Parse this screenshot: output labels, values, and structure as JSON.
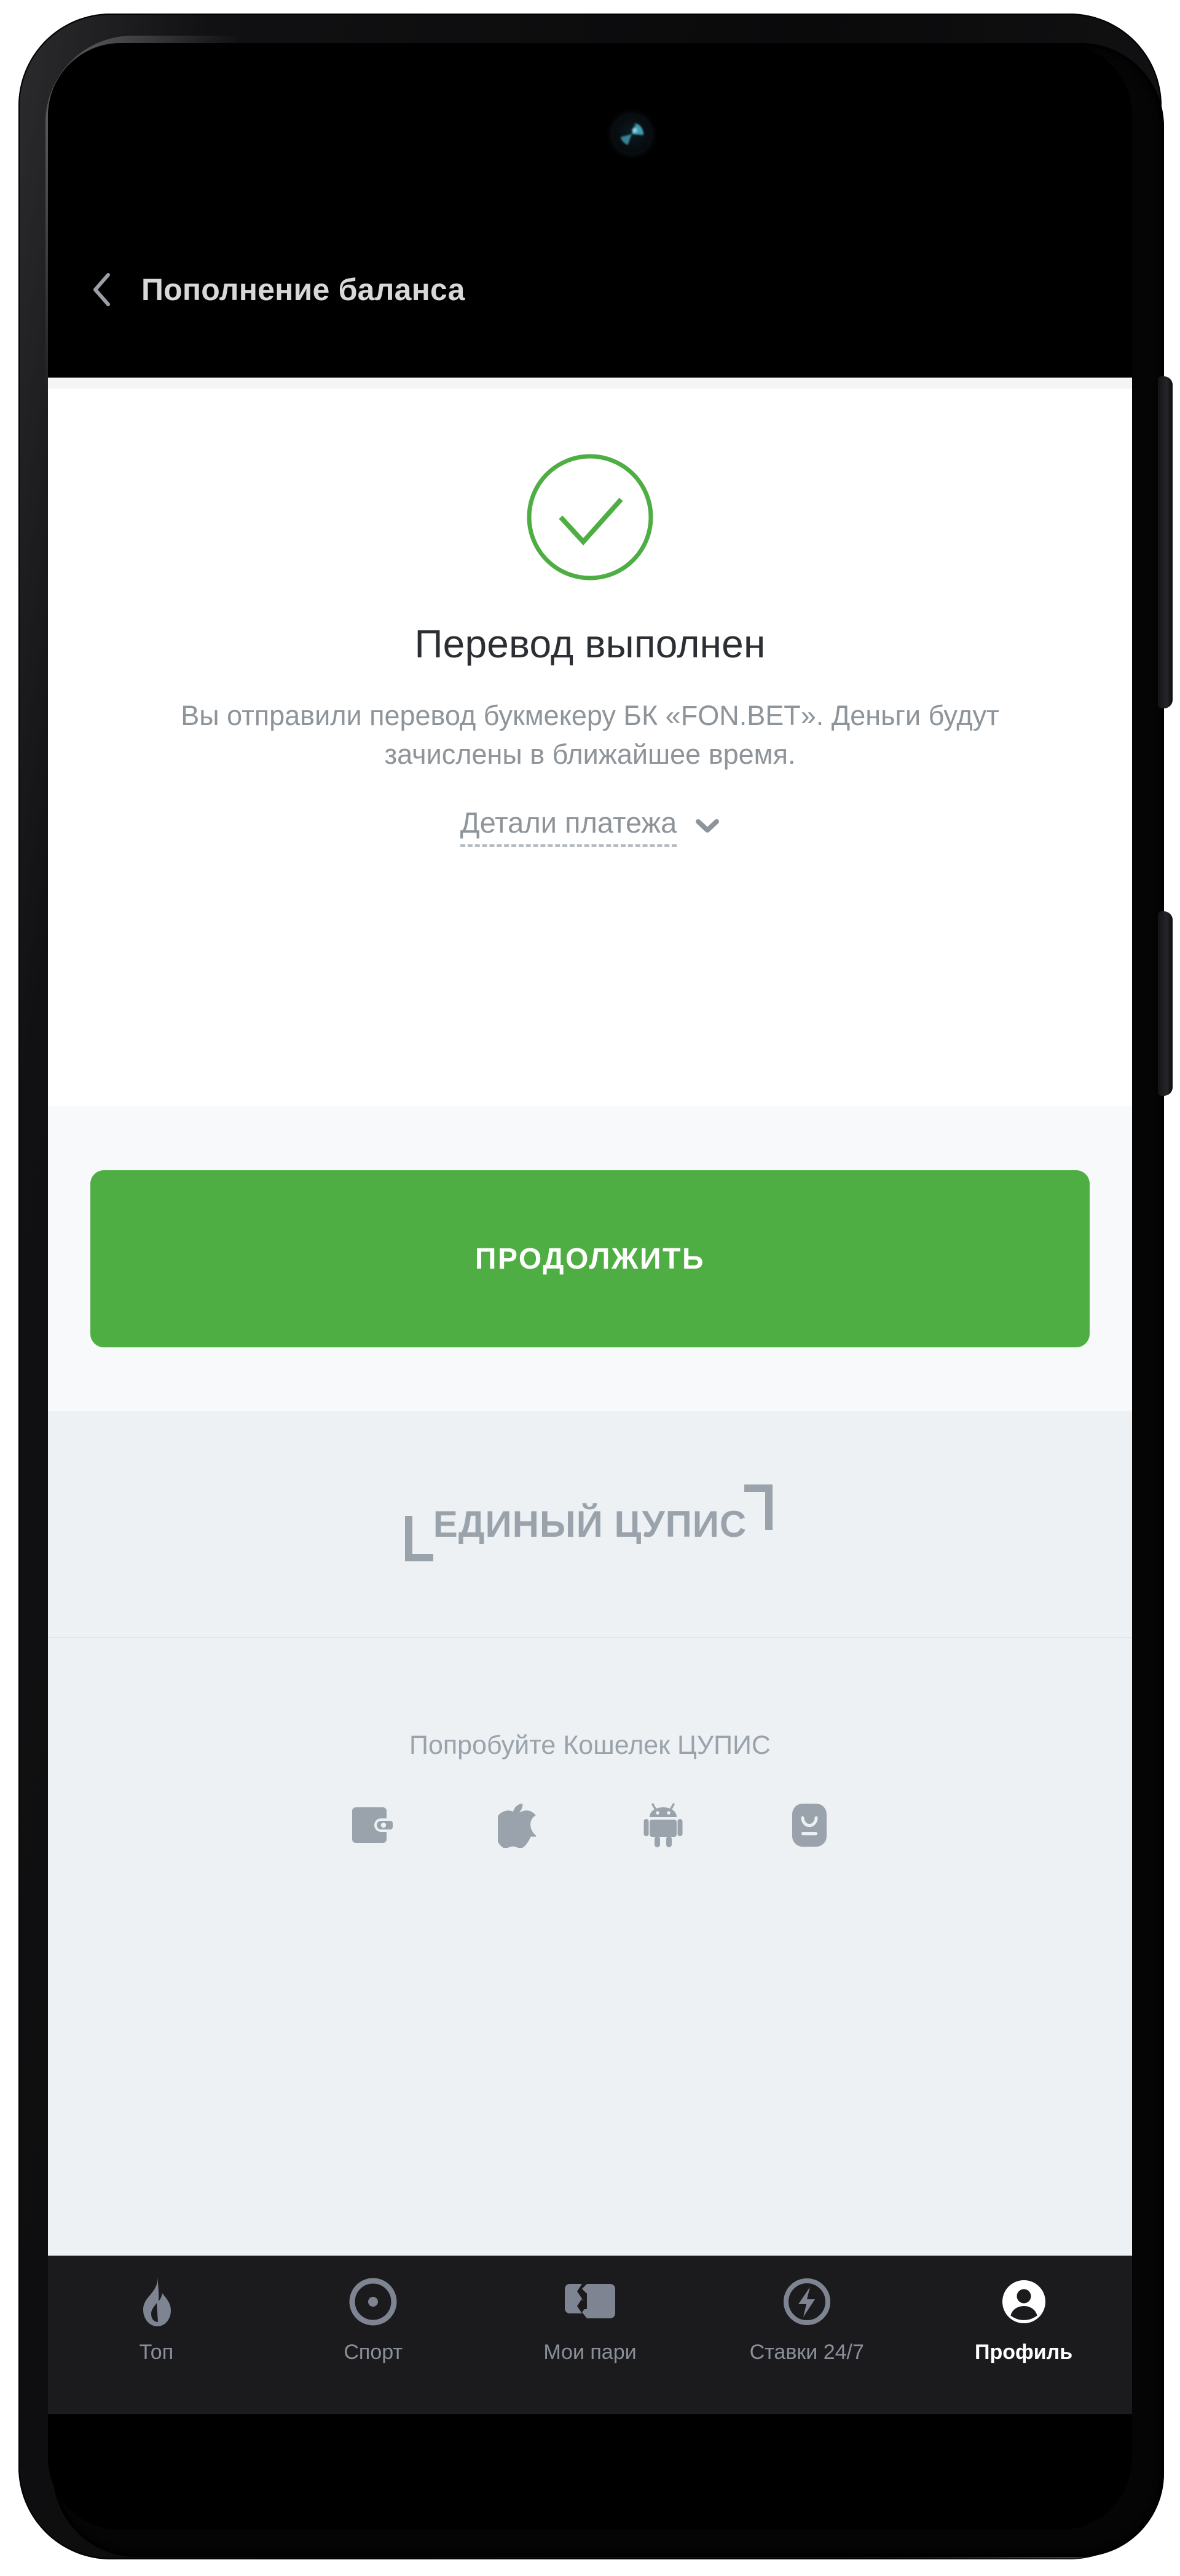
{
  "device": {
    "camera_icon": "front-camera-punch-hole",
    "hardware_buttons": [
      "volume-rocker",
      "power-button"
    ]
  },
  "header": {
    "back_icon": "chevron-left-icon",
    "title": "Пополнение баланса"
  },
  "success": {
    "status_icon": "check-circle-icon",
    "accent_color": "#4fae43",
    "title": "Перевод выполнен",
    "description": "Вы отправили перевод букмекеру БК «FON.BET». Деньги будут зачислены в ближайшее время.",
    "details_label": "Детали платежа",
    "details_caret_icon": "chevron-down-icon"
  },
  "cta": {
    "continue_label": "ПРОДОЛЖИТЬ",
    "color": "#4fae43"
  },
  "brand": {
    "logo_text": "ЕДИНЫЙ ЦУПИС",
    "bracket_left_icon": "corner-bracket-bottom-left-icon",
    "bracket_right_icon": "corner-bracket-top-right-icon",
    "color": "#9aa3ab"
  },
  "promo": {
    "text": "Попробуйте Кошелек ЦУПИС",
    "icons": [
      {
        "name": "wallet-icon"
      },
      {
        "name": "apple-icon"
      },
      {
        "name": "android-icon"
      },
      {
        "name": "appgallery-icon"
      }
    ]
  },
  "bottom_nav": {
    "items": [
      {
        "label": "Топ",
        "icon": "flame-icon",
        "active": false
      },
      {
        "label": "Спорт",
        "icon": "target-circle-icon",
        "active": false
      },
      {
        "label": "Мои пари",
        "icon": "ticket-icon",
        "active": false
      },
      {
        "label": "Ставки 24/7",
        "icon": "lightning-bolt-icon",
        "active": false
      },
      {
        "label": "Профиль",
        "icon": "user-avatar-icon",
        "active": true
      }
    ]
  }
}
